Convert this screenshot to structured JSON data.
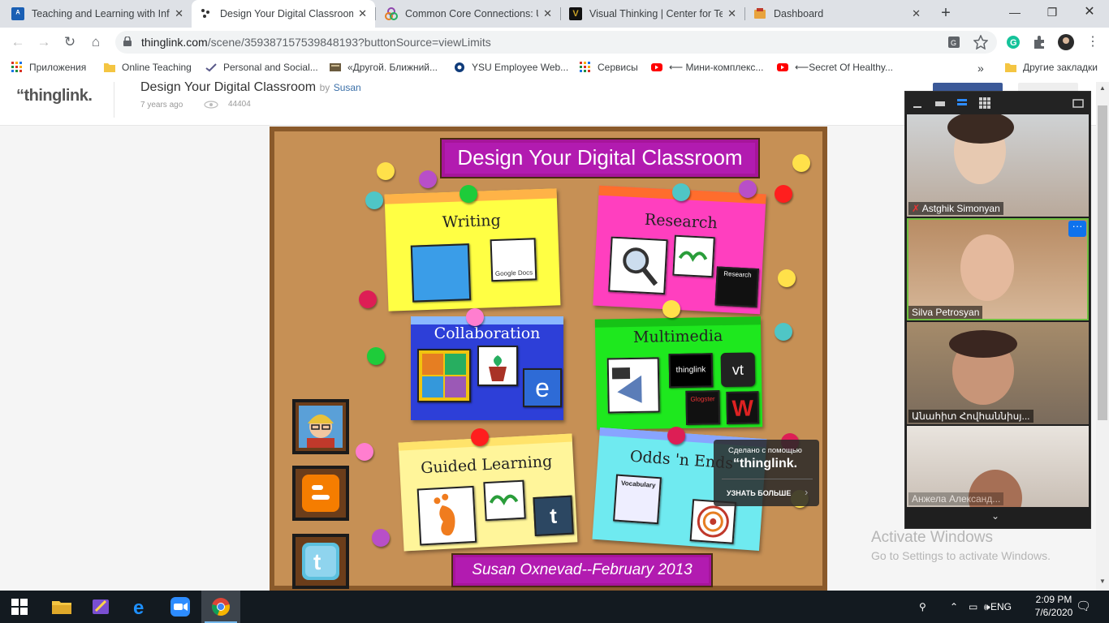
{
  "browser": {
    "tabs": [
      {
        "title": "Teaching and Learning with Inf",
        "active": false
      },
      {
        "title": "Design Your Digital Classroom",
        "active": true
      },
      {
        "title": "Common Core Connections: U",
        "active": false
      },
      {
        "title": "Visual Thinking | Center for Tea",
        "active": false
      },
      {
        "title": "Dashboard",
        "active": false
      }
    ],
    "url_host": "thinglink.com",
    "url_path": "/scene/359387157539848193?buttonSource=viewLimits",
    "bookmarks": [
      {
        "label": "Приложения",
        "icon": "apps-grid-icon"
      },
      {
        "label": "Online Teaching",
        "icon": "folder-icon"
      },
      {
        "label": "Personal and Social...",
        "icon": "bookmark-icon"
      },
      {
        "label": "«Другой. Ближний...",
        "icon": "bookmark-icon"
      },
      {
        "label": "YSU Employee Web...",
        "icon": "bookmark-icon"
      },
      {
        "label": "Сервисы",
        "icon": "apps-grid-icon"
      },
      {
        "label": "⟵ Мини-комплекс...",
        "icon": "youtube-icon"
      },
      {
        "label": "⟵Secret Of Healthy...",
        "icon": "youtube-icon"
      }
    ],
    "other_bookmarks": "Другие закладки",
    "overflow": "»"
  },
  "thinglink": {
    "logo": "“thinglink.",
    "scene_title": "Design Your Digital Classroom",
    "by": "by",
    "author": "Susan",
    "age": "7 years ago",
    "views": "44404",
    "board_title": "Design Your Digital Classroom",
    "notes": [
      {
        "label": "Writing"
      },
      {
        "label": "Research"
      },
      {
        "label": "Collaboration"
      },
      {
        "label": "Multimedia"
      },
      {
        "label": "Guided Learning"
      },
      {
        "label": "Odds 'n Ends"
      }
    ],
    "icon_labels": {
      "google_docs": "Google Docs",
      "research": "Research",
      "thinglink": "thinglink",
      "vt": "vt",
      "glogster": "Glogster",
      "vocabulary": "Vocabulary",
      "e": "e",
      "t": "t",
      "w": "W"
    },
    "footer": "Susan Oxnevad--February 2013",
    "made_with": "Сделано с помощью",
    "made_with_logo": "“thinglink.",
    "learn_more": "УЗНАТЬ БОЛЬШЕ"
  },
  "zoom": {
    "participants": [
      {
        "name": "Astghik Simonyan",
        "muted": true
      },
      {
        "name": "Silva Petrosyan",
        "muted": false
      },
      {
        "name": "Անահիտ Հովհաննիսյ...",
        "muted": false
      },
      {
        "name": "Анжела Александ...",
        "muted": false
      }
    ],
    "more": "···"
  },
  "windows": {
    "activate_title": "Activate Windows",
    "activate_sub": "Go to Settings to activate Windows.",
    "lang": "ENG",
    "time": "2:09 PM",
    "date": "7/6/2020"
  }
}
